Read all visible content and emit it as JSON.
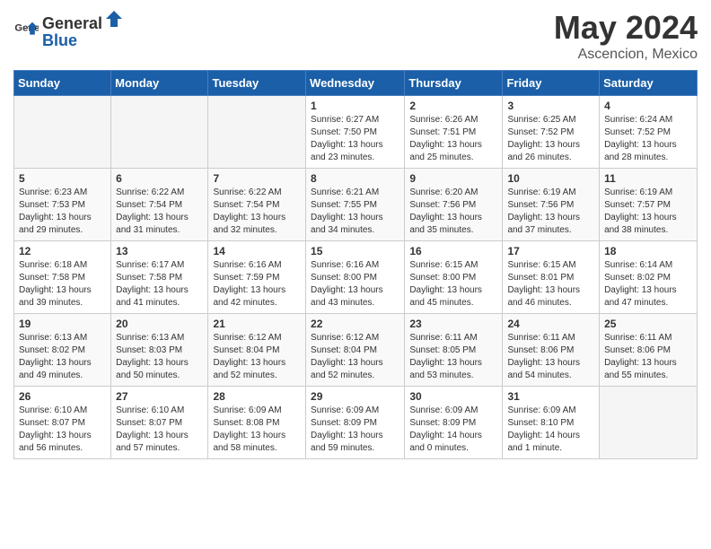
{
  "header": {
    "logo_general": "General",
    "logo_blue": "Blue",
    "title": "May 2024",
    "location": "Ascencion, Mexico"
  },
  "weekdays": [
    "Sunday",
    "Monday",
    "Tuesday",
    "Wednesday",
    "Thursday",
    "Friday",
    "Saturday"
  ],
  "weeks": [
    [
      {
        "day": "",
        "sunrise": "",
        "sunset": "",
        "daylight": ""
      },
      {
        "day": "",
        "sunrise": "",
        "sunset": "",
        "daylight": ""
      },
      {
        "day": "",
        "sunrise": "",
        "sunset": "",
        "daylight": ""
      },
      {
        "day": "1",
        "sunrise": "Sunrise: 6:27 AM",
        "sunset": "Sunset: 7:50 PM",
        "daylight": "Daylight: 13 hours and 23 minutes."
      },
      {
        "day": "2",
        "sunrise": "Sunrise: 6:26 AM",
        "sunset": "Sunset: 7:51 PM",
        "daylight": "Daylight: 13 hours and 25 minutes."
      },
      {
        "day": "3",
        "sunrise": "Sunrise: 6:25 AM",
        "sunset": "Sunset: 7:52 PM",
        "daylight": "Daylight: 13 hours and 26 minutes."
      },
      {
        "day": "4",
        "sunrise": "Sunrise: 6:24 AM",
        "sunset": "Sunset: 7:52 PM",
        "daylight": "Daylight: 13 hours and 28 minutes."
      }
    ],
    [
      {
        "day": "5",
        "sunrise": "Sunrise: 6:23 AM",
        "sunset": "Sunset: 7:53 PM",
        "daylight": "Daylight: 13 hours and 29 minutes."
      },
      {
        "day": "6",
        "sunrise": "Sunrise: 6:22 AM",
        "sunset": "Sunset: 7:54 PM",
        "daylight": "Daylight: 13 hours and 31 minutes."
      },
      {
        "day": "7",
        "sunrise": "Sunrise: 6:22 AM",
        "sunset": "Sunset: 7:54 PM",
        "daylight": "Daylight: 13 hours and 32 minutes."
      },
      {
        "day": "8",
        "sunrise": "Sunrise: 6:21 AM",
        "sunset": "Sunset: 7:55 PM",
        "daylight": "Daylight: 13 hours and 34 minutes."
      },
      {
        "day": "9",
        "sunrise": "Sunrise: 6:20 AM",
        "sunset": "Sunset: 7:56 PM",
        "daylight": "Daylight: 13 hours and 35 minutes."
      },
      {
        "day": "10",
        "sunrise": "Sunrise: 6:19 AM",
        "sunset": "Sunset: 7:56 PM",
        "daylight": "Daylight: 13 hours and 37 minutes."
      },
      {
        "day": "11",
        "sunrise": "Sunrise: 6:19 AM",
        "sunset": "Sunset: 7:57 PM",
        "daylight": "Daylight: 13 hours and 38 minutes."
      }
    ],
    [
      {
        "day": "12",
        "sunrise": "Sunrise: 6:18 AM",
        "sunset": "Sunset: 7:58 PM",
        "daylight": "Daylight: 13 hours and 39 minutes."
      },
      {
        "day": "13",
        "sunrise": "Sunrise: 6:17 AM",
        "sunset": "Sunset: 7:58 PM",
        "daylight": "Daylight: 13 hours and 41 minutes."
      },
      {
        "day": "14",
        "sunrise": "Sunrise: 6:16 AM",
        "sunset": "Sunset: 7:59 PM",
        "daylight": "Daylight: 13 hours and 42 minutes."
      },
      {
        "day": "15",
        "sunrise": "Sunrise: 6:16 AM",
        "sunset": "Sunset: 8:00 PM",
        "daylight": "Daylight: 13 hours and 43 minutes."
      },
      {
        "day": "16",
        "sunrise": "Sunrise: 6:15 AM",
        "sunset": "Sunset: 8:00 PM",
        "daylight": "Daylight: 13 hours and 45 minutes."
      },
      {
        "day": "17",
        "sunrise": "Sunrise: 6:15 AM",
        "sunset": "Sunset: 8:01 PM",
        "daylight": "Daylight: 13 hours and 46 minutes."
      },
      {
        "day": "18",
        "sunrise": "Sunrise: 6:14 AM",
        "sunset": "Sunset: 8:02 PM",
        "daylight": "Daylight: 13 hours and 47 minutes."
      }
    ],
    [
      {
        "day": "19",
        "sunrise": "Sunrise: 6:13 AM",
        "sunset": "Sunset: 8:02 PM",
        "daylight": "Daylight: 13 hours and 49 minutes."
      },
      {
        "day": "20",
        "sunrise": "Sunrise: 6:13 AM",
        "sunset": "Sunset: 8:03 PM",
        "daylight": "Daylight: 13 hours and 50 minutes."
      },
      {
        "day": "21",
        "sunrise": "Sunrise: 6:12 AM",
        "sunset": "Sunset: 8:04 PM",
        "daylight": "Daylight: 13 hours and 52 minutes."
      },
      {
        "day": "22",
        "sunrise": "Sunrise: 6:12 AM",
        "sunset": "Sunset: 8:04 PM",
        "daylight": "Daylight: 13 hours and 52 minutes."
      },
      {
        "day": "23",
        "sunrise": "Sunrise: 6:11 AM",
        "sunset": "Sunset: 8:05 PM",
        "daylight": "Daylight: 13 hours and 53 minutes."
      },
      {
        "day": "24",
        "sunrise": "Sunrise: 6:11 AM",
        "sunset": "Sunset: 8:06 PM",
        "daylight": "Daylight: 13 hours and 54 minutes."
      },
      {
        "day": "25",
        "sunrise": "Sunrise: 6:11 AM",
        "sunset": "Sunset: 8:06 PM",
        "daylight": "Daylight: 13 hours and 55 minutes."
      }
    ],
    [
      {
        "day": "26",
        "sunrise": "Sunrise: 6:10 AM",
        "sunset": "Sunset: 8:07 PM",
        "daylight": "Daylight: 13 hours and 56 minutes."
      },
      {
        "day": "27",
        "sunrise": "Sunrise: 6:10 AM",
        "sunset": "Sunset: 8:07 PM",
        "daylight": "Daylight: 13 hours and 57 minutes."
      },
      {
        "day": "28",
        "sunrise": "Sunrise: 6:09 AM",
        "sunset": "Sunset: 8:08 PM",
        "daylight": "Daylight: 13 hours and 58 minutes."
      },
      {
        "day": "29",
        "sunrise": "Sunrise: 6:09 AM",
        "sunset": "Sunset: 8:09 PM",
        "daylight": "Daylight: 13 hours and 59 minutes."
      },
      {
        "day": "30",
        "sunrise": "Sunrise: 6:09 AM",
        "sunset": "Sunset: 8:09 PM",
        "daylight": "Daylight: 14 hours and 0 minutes."
      },
      {
        "day": "31",
        "sunrise": "Sunrise: 6:09 AM",
        "sunset": "Sunset: 8:10 PM",
        "daylight": "Daylight: 14 hours and 1 minute."
      },
      {
        "day": "",
        "sunrise": "",
        "sunset": "",
        "daylight": ""
      }
    ]
  ]
}
